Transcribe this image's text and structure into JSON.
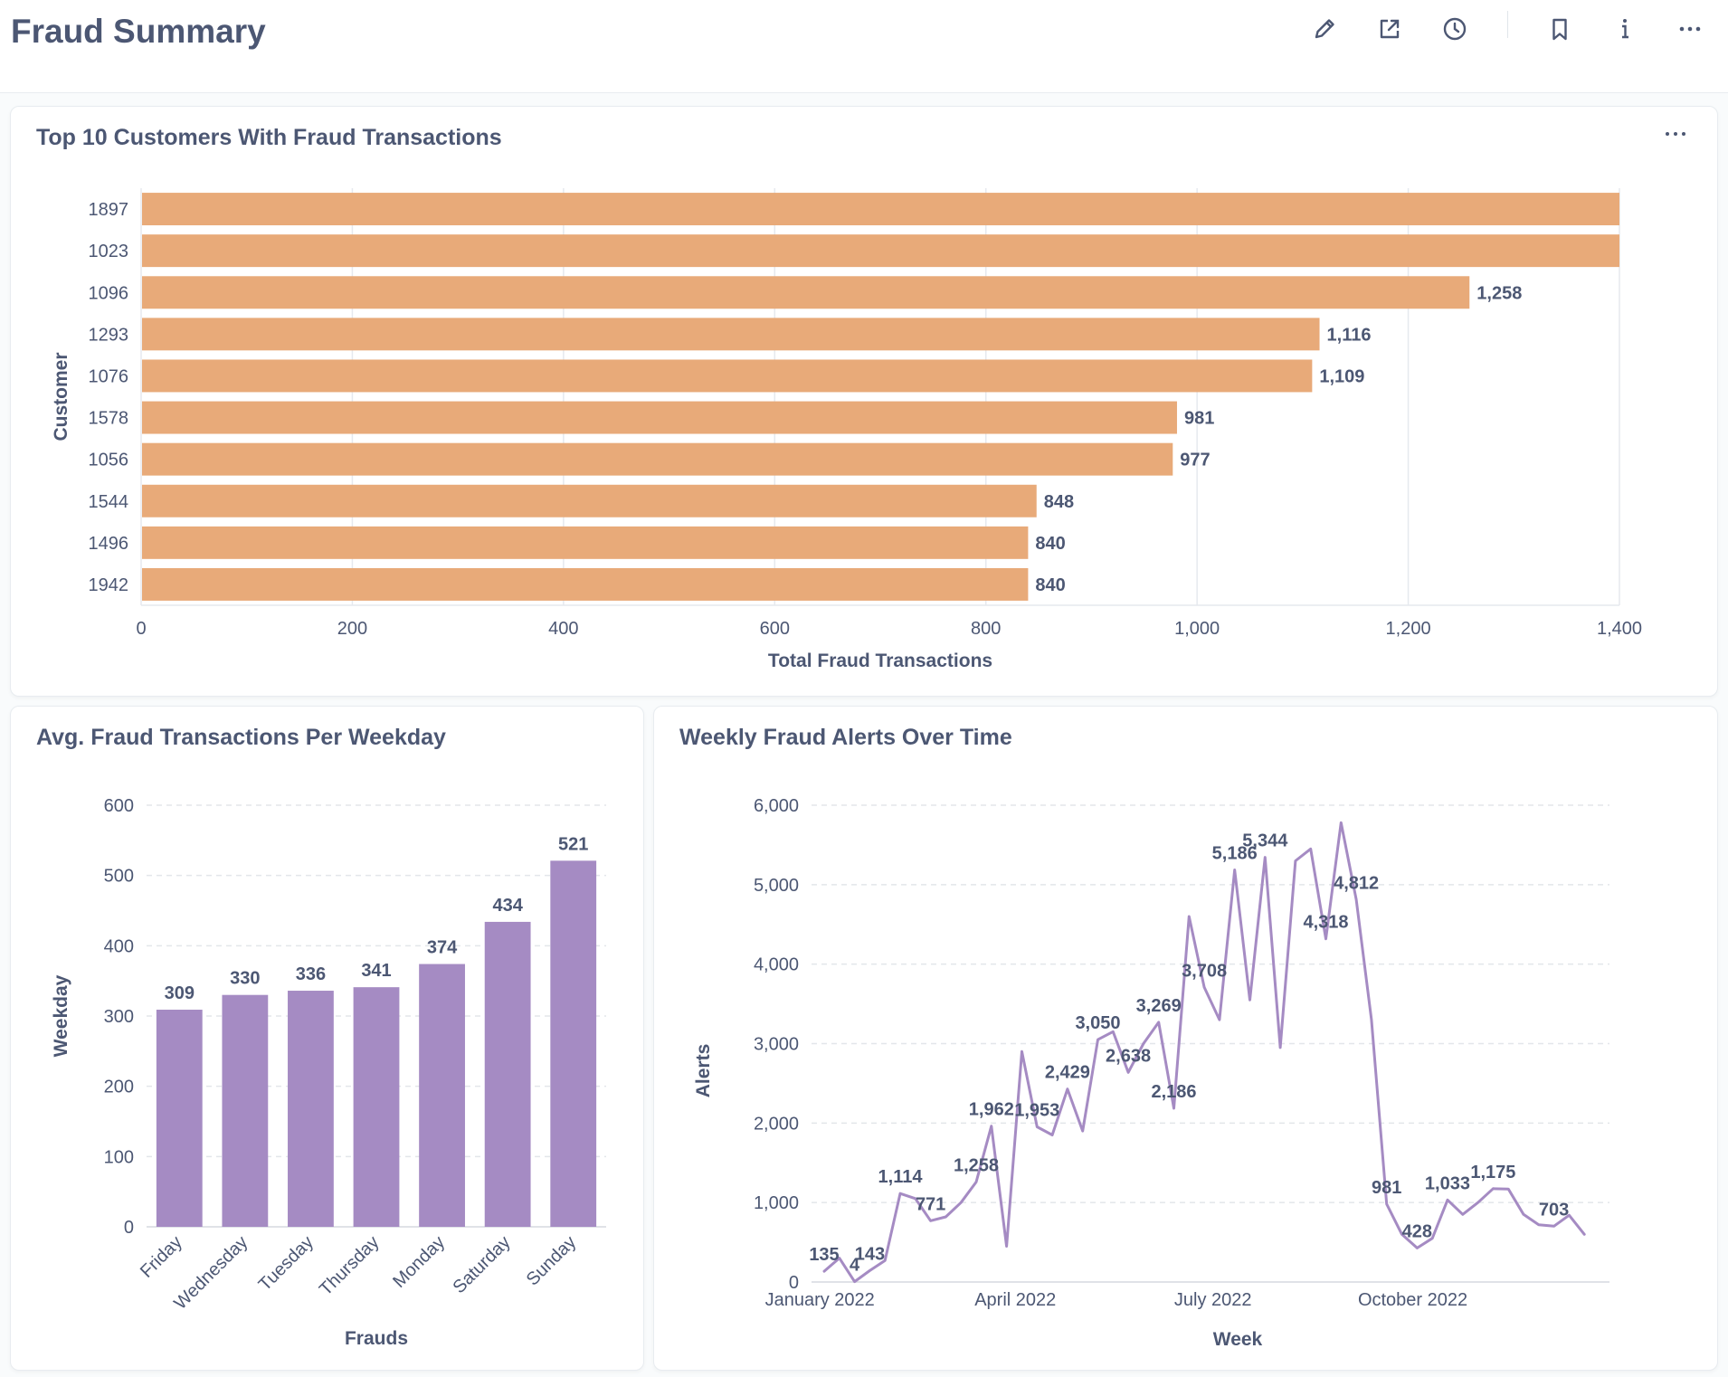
{
  "page": {
    "title": "Fraud Summary"
  },
  "toolbar": {
    "icons": [
      "pencil-icon",
      "external-link-icon",
      "clock-icon",
      "bookmark-icon",
      "info-icon",
      "more-icon"
    ]
  },
  "colors": {
    "bar_orange": "#e8aa79",
    "bar_purple": "#a58bc3",
    "line_purple": "#a58bc3",
    "text": "#4c5773"
  },
  "chart_data": [
    {
      "type": "bar",
      "orientation": "horizontal",
      "title": "Top 10 Customers With Fraud Transactions",
      "xlabel": "Total Fraud Transactions",
      "ylabel": "Customer",
      "categories": [
        "1897",
        "1023",
        "1096",
        "1293",
        "1076",
        "1578",
        "1056",
        "1544",
        "1496",
        "1942"
      ],
      "values": [
        1400,
        1400,
        1258,
        1116,
        1109,
        981,
        977,
        848,
        840,
        840
      ],
      "data_labels": [
        "",
        "",
        "1,258",
        "1,116",
        "1,109",
        "981",
        "977",
        "848",
        "840",
        "840"
      ],
      "xlim": [
        0,
        1400
      ],
      "x_ticks": [
        0,
        200,
        400,
        600,
        800,
        1000,
        1200,
        1400
      ],
      "x_tick_labels": [
        "0",
        "200",
        "400",
        "600",
        "800",
        "1,000",
        "1,200",
        "1,400"
      ],
      "grid": true
    },
    {
      "type": "bar",
      "title": "Avg. Fraud Transactions Per Weekday",
      "xlabel": "Frauds",
      "ylabel": "Weekday",
      "categories": [
        "Friday",
        "Wednesday",
        "Tuesday",
        "Thursday",
        "Monday",
        "Saturday",
        "Sunday"
      ],
      "values": [
        309,
        330,
        336,
        341,
        374,
        434,
        521
      ],
      "data_labels": [
        "309",
        "330",
        "336",
        "341",
        "374",
        "434",
        "521"
      ],
      "ylim": [
        0,
        600
      ],
      "y_ticks": [
        0,
        100,
        200,
        300,
        400,
        500,
        600
      ],
      "y_tick_labels": [
        "0",
        "100",
        "200",
        "300",
        "400",
        "500",
        "600"
      ],
      "grid": true
    },
    {
      "type": "line",
      "title": "Weekly Fraud Alerts Over Time",
      "xlabel": "Week",
      "ylabel": "Alerts",
      "x": [
        "2022-01-03",
        "2022-01-10",
        "2022-01-17",
        "2022-01-24",
        "2022-01-31",
        "2022-02-07",
        "2022-02-14",
        "2022-02-21",
        "2022-02-28",
        "2022-03-07",
        "2022-03-14",
        "2022-03-21",
        "2022-03-28",
        "2022-04-04",
        "2022-04-11",
        "2022-04-18",
        "2022-04-25",
        "2022-05-02",
        "2022-05-09",
        "2022-05-16",
        "2022-05-23",
        "2022-05-30",
        "2022-06-06",
        "2022-06-13",
        "2022-06-20",
        "2022-06-27",
        "2022-07-04",
        "2022-07-11",
        "2022-07-18",
        "2022-07-25",
        "2022-08-01",
        "2022-08-08",
        "2022-08-15",
        "2022-08-22",
        "2022-08-29",
        "2022-09-05",
        "2022-09-12",
        "2022-09-19",
        "2022-09-26",
        "2022-10-03",
        "2022-10-10",
        "2022-10-17",
        "2022-10-24",
        "2022-10-31",
        "2022-11-07",
        "2022-11-14",
        "2022-11-21",
        "2022-11-28",
        "2022-12-05",
        "2022-12-12",
        "2022-12-19",
        "2022-12-26"
      ],
      "values": [
        135,
        300,
        4,
        143,
        270,
        1114,
        1050,
        771,
        820,
        1000,
        1258,
        1962,
        450,
        2900,
        1953,
        1850,
        2429,
        1900,
        3050,
        3150,
        2638,
        3000,
        3269,
        2186,
        4600,
        3708,
        3300,
        5186,
        3550,
        5344,
        2950,
        5300,
        5450,
        4318,
        5780,
        4812,
        3300,
        981,
        600,
        428,
        550,
        1033,
        850,
        1000,
        1175,
        1170,
        850,
        720,
        703,
        840,
        600
      ],
      "annotations": [
        {
          "x": "2022-01-03",
          "label": "135"
        },
        {
          "x": "2022-01-17",
          "label": "4"
        },
        {
          "x": "2022-01-24",
          "label": "143"
        },
        {
          "x": "2022-02-07",
          "label": "1,114"
        },
        {
          "x": "2022-02-21",
          "label": "771"
        },
        {
          "x": "2022-03-14",
          "label": "1,258"
        },
        {
          "x": "2022-03-21",
          "label": "1,962"
        },
        {
          "x": "2022-04-11",
          "label": "1,953"
        },
        {
          "x": "2022-04-25",
          "label": "2,429"
        },
        {
          "x": "2022-05-09",
          "label": "3,050"
        },
        {
          "x": "2022-05-23",
          "label": "2,638"
        },
        {
          "x": "2022-06-06",
          "label": "3,269"
        },
        {
          "x": "2022-06-13",
          "label": "2,186"
        },
        {
          "x": "2022-06-27",
          "label": "3,708"
        },
        {
          "x": "2022-07-11",
          "label": "5,186"
        },
        {
          "x": "2022-07-25",
          "label": "5,344"
        },
        {
          "x": "2022-08-22",
          "label": "4,318"
        },
        {
          "x": "2022-09-05",
          "label": "4,812"
        },
        {
          "x": "2022-09-19",
          "label": "981"
        },
        {
          "x": "2022-10-03",
          "label": "428"
        },
        {
          "x": "2022-10-17",
          "label": "1,033"
        },
        {
          "x": "2022-11-07",
          "label": "1,175"
        },
        {
          "x": "2022-12-05",
          "label": "703"
        }
      ],
      "ylim": [
        0,
        6000
      ],
      "y_ticks": [
        0,
        1000,
        2000,
        3000,
        4000,
        5000,
        6000
      ],
      "y_tick_labels": [
        "0",
        "1,000",
        "2,000",
        "3,000",
        "4,000",
        "5,000",
        "6,000"
      ],
      "x_ticks": [
        "2022-01-01",
        "2022-04-01",
        "2022-07-01",
        "2022-10-01"
      ],
      "x_tick_labels": [
        "January 2022",
        "April 2022",
        "July 2022",
        "October 2022"
      ],
      "grid": true
    }
  ]
}
